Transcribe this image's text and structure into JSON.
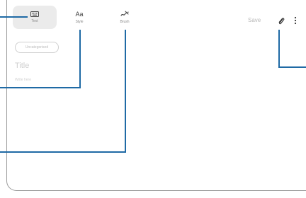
{
  "toolbar": {
    "tools": [
      {
        "label": "Text",
        "icon": "keyboard-icon",
        "selected": true
      },
      {
        "label": "Style",
        "icon": "text-style-icon",
        "glyph": "Aa",
        "selected": false
      },
      {
        "label": "Brush",
        "icon": "brush-icon",
        "selected": false
      }
    ],
    "save_label": "Save",
    "attach_icon": "paperclip-icon",
    "more_icon": "more-options-icon"
  },
  "editor": {
    "category_chip": "Uncategorised",
    "title_placeholder": "Title",
    "body_placeholder": "Write here"
  },
  "colors": {
    "callout_line": "#1f6aa5",
    "selected_tool_bg": "#ebebeb"
  }
}
